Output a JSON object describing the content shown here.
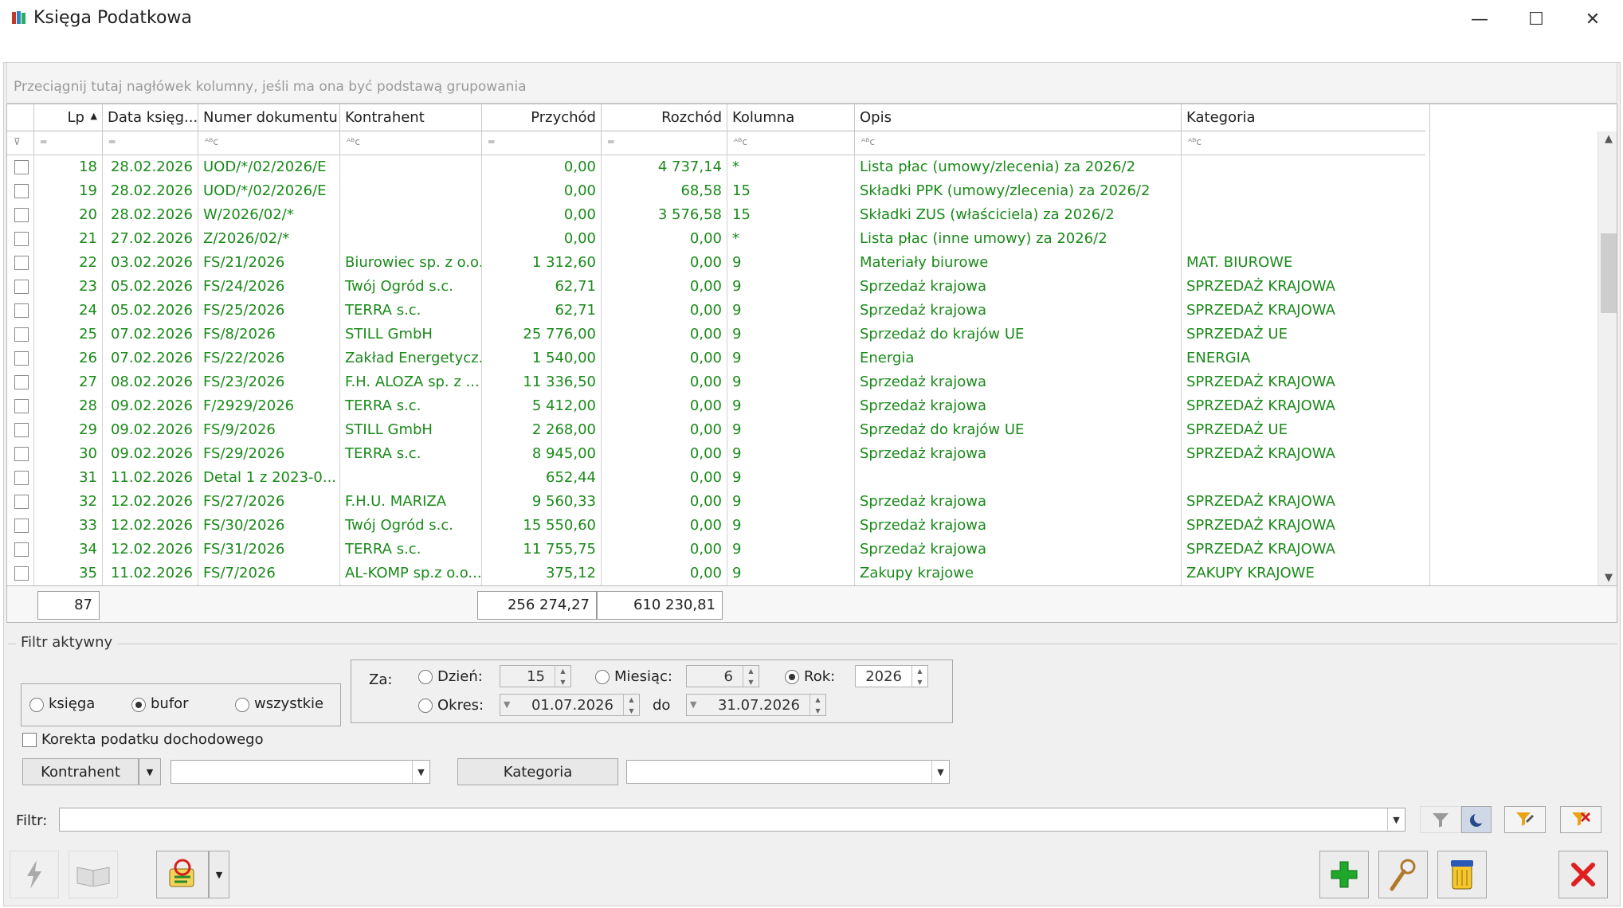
{
  "window": {
    "title": "Księga Podatkowa",
    "minimize": "—",
    "maximize": "☐",
    "close": "✕"
  },
  "group_hint": "Przeciągnij tutaj nagłówek kolumny, jeśli ma ona być podstawą grupowania",
  "columns": [
    "Lp",
    "Data księg...",
    "Numer dokumentu",
    "Kontrahent",
    "Przychód",
    "Rozchód",
    "Kolumna",
    "Opis",
    "Kategoria"
  ],
  "rows": [
    {
      "lp": "18",
      "data": "28.02.2026",
      "numer": "UOD/*/02/2026/E",
      "kontrahent": "",
      "przychod": "0,00",
      "rozchod": "4 737,14",
      "kolumna": "*",
      "opis": "Lista płac (umowy/zlecenia) za 2026/2",
      "kategoria": ""
    },
    {
      "lp": "19",
      "data": "28.02.2026",
      "numer": "UOD/*/02/2026/E",
      "kontrahent": "",
      "przychod": "0,00",
      "rozchod": "68,58",
      "kolumna": "15",
      "opis": "Składki PPK (umowy/zlecenia) za 2026/2",
      "kategoria": ""
    },
    {
      "lp": "20",
      "data": "28.02.2026",
      "numer": "W/2026/02/*",
      "kontrahent": "",
      "przychod": "0,00",
      "rozchod": "3 576,58",
      "kolumna": "15",
      "opis": "Składki ZUS (właściciela) za 2026/2",
      "kategoria": ""
    },
    {
      "lp": "21",
      "data": "27.02.2026",
      "numer": "Z/2026/02/*",
      "kontrahent": "",
      "przychod": "0,00",
      "rozchod": "0,00",
      "kolumna": "*",
      "opis": "Lista płac (inne umowy) za 2026/2",
      "kategoria": ""
    },
    {
      "lp": "22",
      "data": "03.02.2026",
      "numer": "FS/21/2026",
      "kontrahent": "Biurowiec sp. z o.o.",
      "przychod": "1 312,60",
      "rozchod": "0,00",
      "kolumna": "9",
      "opis": "Materiały biurowe",
      "kategoria": "MAT. BIUROWE"
    },
    {
      "lp": "23",
      "data": "05.02.2026",
      "numer": "FS/24/2026",
      "kontrahent": "Twój Ogród s.c.",
      "przychod": "62,71",
      "rozchod": "0,00",
      "kolumna": "9",
      "opis": "Sprzedaż krajowa",
      "kategoria": "SPRZEDAŻ KRAJOWA"
    },
    {
      "lp": "24",
      "data": "05.02.2026",
      "numer": "FS/25/2026",
      "kontrahent": "TERRA s.c.",
      "przychod": "62,71",
      "rozchod": "0,00",
      "kolumna": "9",
      "opis": "Sprzedaż krajowa",
      "kategoria": "SPRZEDAŻ KRAJOWA"
    },
    {
      "lp": "25",
      "data": "07.02.2026",
      "numer": "FS/8/2026",
      "kontrahent": "STILL GmbH",
      "przychod": "25 776,00",
      "rozchod": "0,00",
      "kolumna": "9",
      "opis": "Sprzedaż do krajów UE",
      "kategoria": "SPRZEDAŻ UE"
    },
    {
      "lp": "26",
      "data": "07.02.2026",
      "numer": "FS/22/2026",
      "kontrahent": "Zakład Energetycz...",
      "przychod": "1 540,00",
      "rozchod": "0,00",
      "kolumna": "9",
      "opis": "Energia",
      "kategoria": "ENERGIA"
    },
    {
      "lp": "27",
      "data": "08.02.2026",
      "numer": "FS/23/2026",
      "kontrahent": "F.H. ALOZA sp. z ...",
      "przychod": "11 336,50",
      "rozchod": "0,00",
      "kolumna": "9",
      "opis": "Sprzedaż krajowa",
      "kategoria": "SPRZEDAŻ KRAJOWA"
    },
    {
      "lp": "28",
      "data": "09.02.2026",
      "numer": "F/2929/2026",
      "kontrahent": "TERRA s.c.",
      "przychod": "5 412,00",
      "rozchod": "0,00",
      "kolumna": "9",
      "opis": "Sprzedaż krajowa",
      "kategoria": "SPRZEDAŻ KRAJOWA"
    },
    {
      "lp": "29",
      "data": "09.02.2026",
      "numer": "FS/9/2026",
      "kontrahent": "STILL GmbH",
      "przychod": "2 268,00",
      "rozchod": "0,00",
      "kolumna": "9",
      "opis": "Sprzedaż do krajów UE",
      "kategoria": "SPRZEDAŻ UE"
    },
    {
      "lp": "30",
      "data": "09.02.2026",
      "numer": "FS/29/2026",
      "kontrahent": "TERRA s.c.",
      "przychod": "8 945,00",
      "rozchod": "0,00",
      "kolumna": "9",
      "opis": "Sprzedaż krajowa",
      "kategoria": "SPRZEDAŻ KRAJOWA"
    },
    {
      "lp": "31",
      "data": "11.02.2026",
      "numer": "Detal 1  z 2023-0...",
      "kontrahent": "",
      "przychod": "652,44",
      "rozchod": "0,00",
      "kolumna": "9",
      "opis": "",
      "kategoria": ""
    },
    {
      "lp": "32",
      "data": "12.02.2026",
      "numer": "FS/27/2026",
      "kontrahent": "F.H.U. MARIZA",
      "przychod": "9 560,33",
      "rozchod": "0,00",
      "kolumna": "9",
      "opis": "Sprzedaż krajowa",
      "kategoria": "SPRZEDAŻ KRAJOWA"
    },
    {
      "lp": "33",
      "data": "12.02.2026",
      "numer": "FS/30/2026",
      "kontrahent": "Twój Ogród s.c.",
      "przychod": "15 550,60",
      "rozchod": "0,00",
      "kolumna": "9",
      "opis": "Sprzedaż krajowa",
      "kategoria": "SPRZEDAŻ KRAJOWA"
    },
    {
      "lp": "34",
      "data": "12.02.2026",
      "numer": "FS/31/2026",
      "kontrahent": "TERRA s.c.",
      "przychod": "11 755,75",
      "rozchod": "0,00",
      "kolumna": "9",
      "opis": "Sprzedaż krajowa",
      "kategoria": "SPRZEDAŻ KRAJOWA"
    },
    {
      "lp": "35",
      "data": "11.02.2026",
      "numer": "FS/7/2026",
      "kontrahent": "AL-KOMP sp.z o.o...",
      "przychod": "375,12",
      "rozchod": "0,00",
      "kolumna": "9",
      "opis": "Zakupy krajowe",
      "kategoria": "ZAKUPY KRAJOWE"
    }
  ],
  "footer": {
    "count": "87",
    "przychod_sum": "256 274,27",
    "rozchod_sum": "610 230,81"
  },
  "filter": {
    "legend": "Filtr aktywny",
    "mode_options": [
      "księga",
      "bufor",
      "wszystkie"
    ],
    "mode_selected": "bufor",
    "za_label": "Za:",
    "dzien_label": "Dzień:",
    "dzien_value": "15",
    "miesiac_label": "Miesiąc:",
    "miesiac_value": "6",
    "rok_label": "Rok:",
    "rok_value": "2026",
    "okres_label": "Okres:",
    "okres_from": "01.07.2026",
    "do_label": "do",
    "okres_to": "31.07.2026",
    "korekta_label": "Korekta podatku dochodowego",
    "kontrahent_button": "Kontrahent",
    "kategoria_button": "Kategoria",
    "filtr_label": "Filtr:"
  },
  "icons": {
    "accent_green": "#1a8a1a",
    "add": "plus-icon",
    "edit": "magnifier-icon",
    "delete": "trash-icon",
    "close": "close-icon"
  }
}
